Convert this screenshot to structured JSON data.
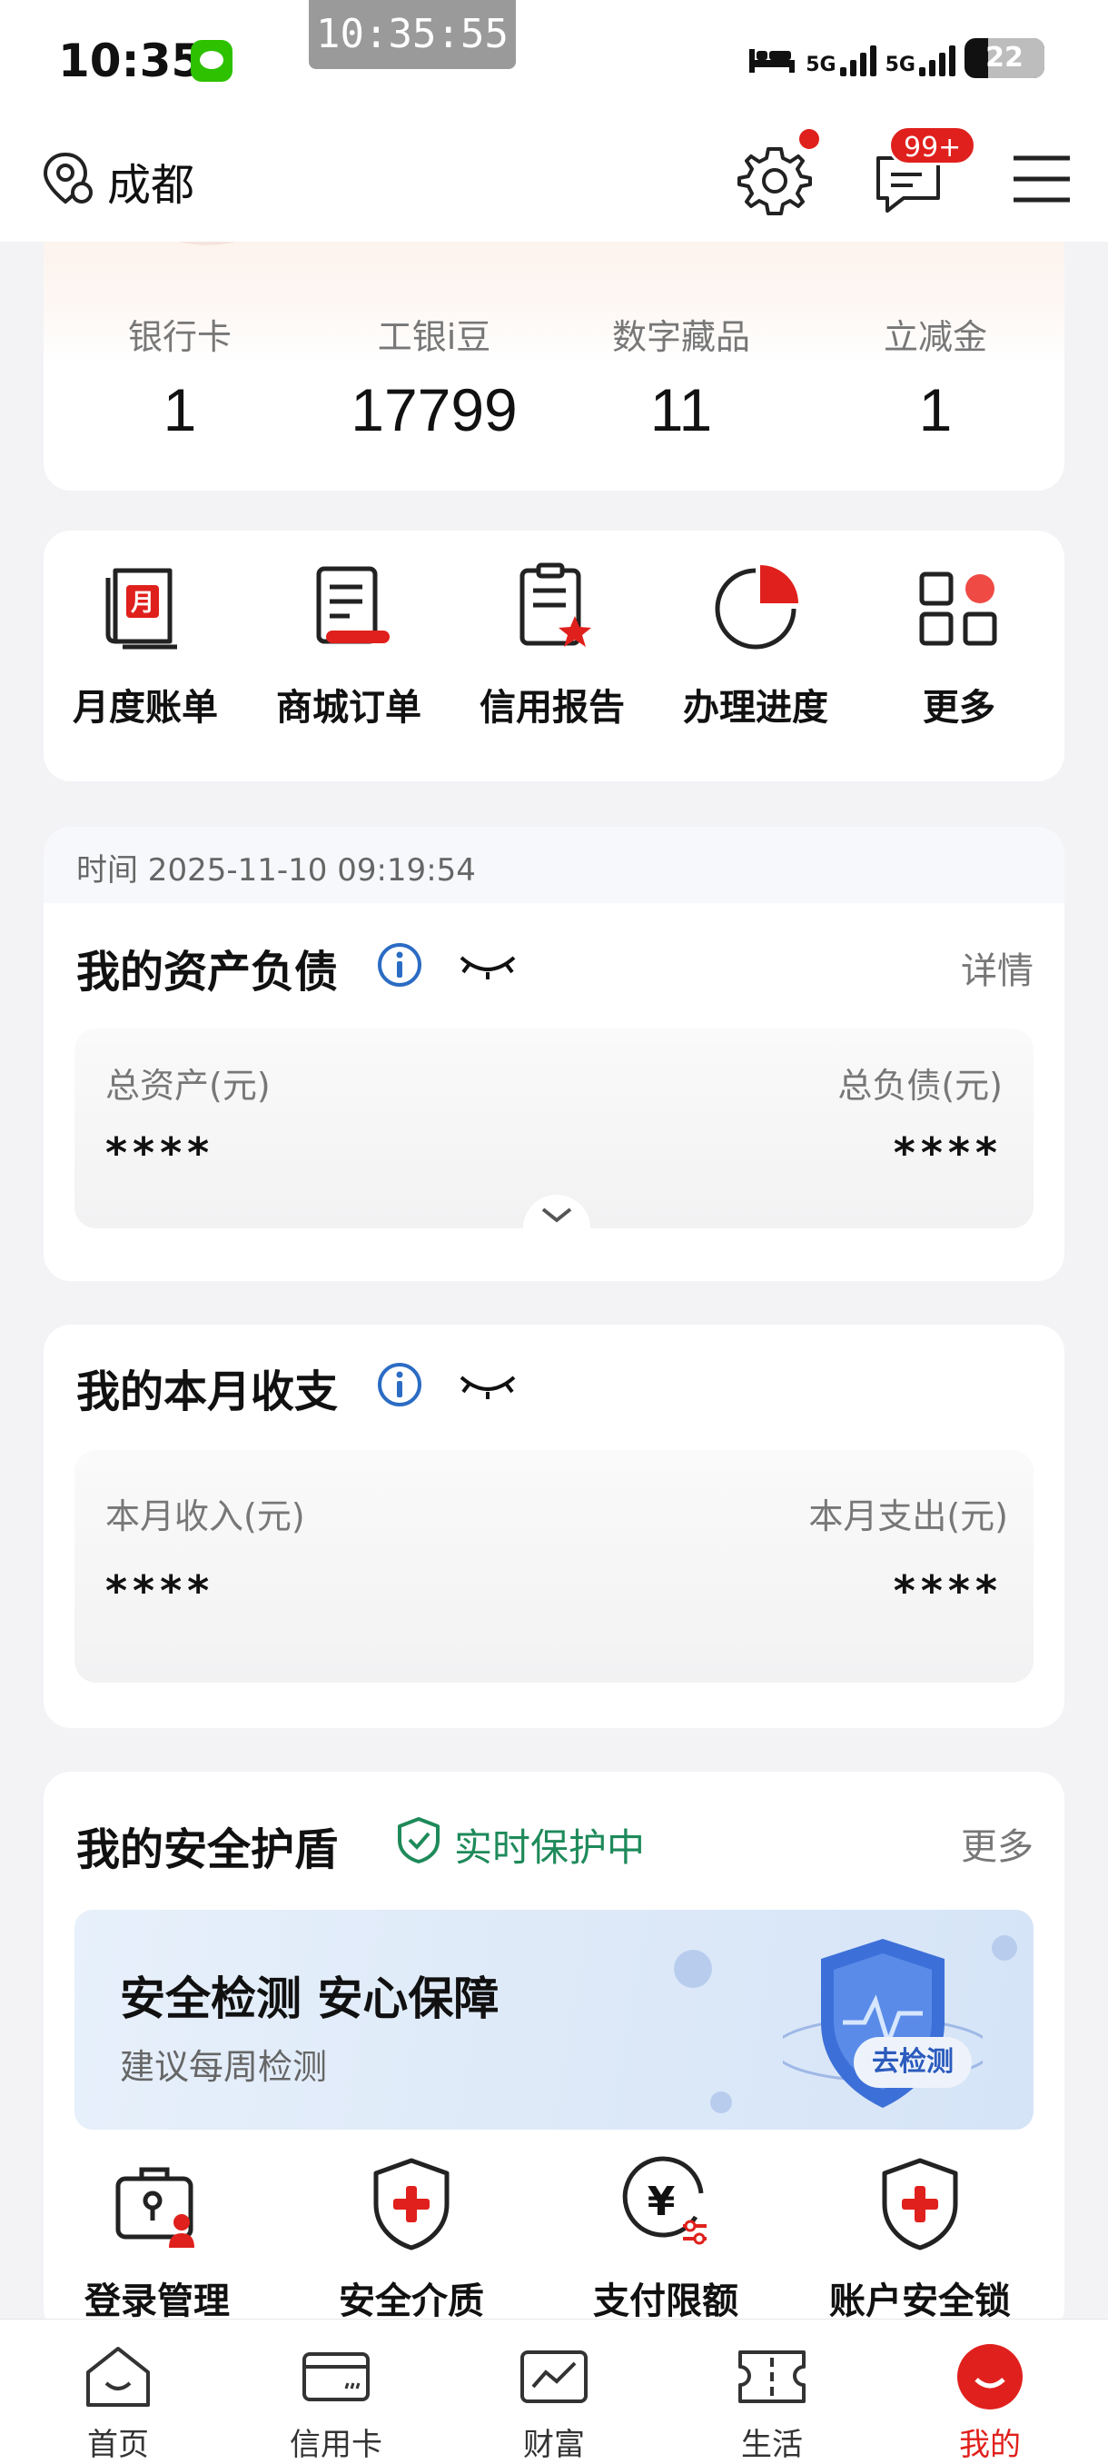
{
  "status_bar": {
    "time": "10:35",
    "clock_overlay": "10:35:55",
    "network_1": "5G",
    "network_2": "5G",
    "battery": "22"
  },
  "header": {
    "location": "成都",
    "message_badge": "99+"
  },
  "stats": [
    {
      "label": "银行卡",
      "value": "1"
    },
    {
      "label": "工银i豆",
      "value": "17799"
    },
    {
      "label": "数字藏品",
      "value": "11"
    },
    {
      "label": "立减金",
      "value": "1"
    }
  ],
  "shortcuts": [
    {
      "label": "月度账单",
      "icon": "monthly-bill-icon"
    },
    {
      "label": "商城订单",
      "icon": "mall-order-icon"
    },
    {
      "label": "信用报告",
      "icon": "credit-report-icon"
    },
    {
      "label": "办理进度",
      "icon": "progress-icon"
    },
    {
      "label": "更多",
      "icon": "more-apps-icon"
    }
  ],
  "assets": {
    "time_text": "时间 2025-11-10 09:19:54",
    "title": "我的资产负债",
    "detail": "详情",
    "total_assets_label": "总资产(元)",
    "total_assets_value": "****",
    "total_liabilities_label": "总负债(元)",
    "total_liabilities_value": "****"
  },
  "monthly": {
    "title": "我的本月收支",
    "income_label": "本月收入(元)",
    "income_value": "****",
    "expense_label": "本月支出(元)",
    "expense_value": "****"
  },
  "security": {
    "title": "我的安全护盾",
    "status": "实时保护中",
    "more": "更多",
    "banner_title": "安全检测 安心保障",
    "banner_subtitle": "建议每周检测",
    "banner_button": "去检测",
    "items": [
      {
        "label": "登录管理",
        "icon": "login-manage-icon"
      },
      {
        "label": "安全介质",
        "icon": "security-medium-icon"
      },
      {
        "label": "支付限额",
        "icon": "payment-limit-icon"
      },
      {
        "label": "账户安全锁",
        "icon": "account-lock-icon"
      }
    ]
  },
  "bottom_nav": [
    {
      "label": "首页",
      "icon": "home-icon"
    },
    {
      "label": "信用卡",
      "icon": "credit-card-icon"
    },
    {
      "label": "财富",
      "icon": "wealth-icon"
    },
    {
      "label": "生活",
      "icon": "life-ticket-icon"
    },
    {
      "label": "我的",
      "icon": "mine-icon",
      "active": true
    }
  ],
  "colors": {
    "brand_red": "#e0201c",
    "protect_green": "#1e8a5a",
    "info_blue": "#2b6cc4"
  }
}
